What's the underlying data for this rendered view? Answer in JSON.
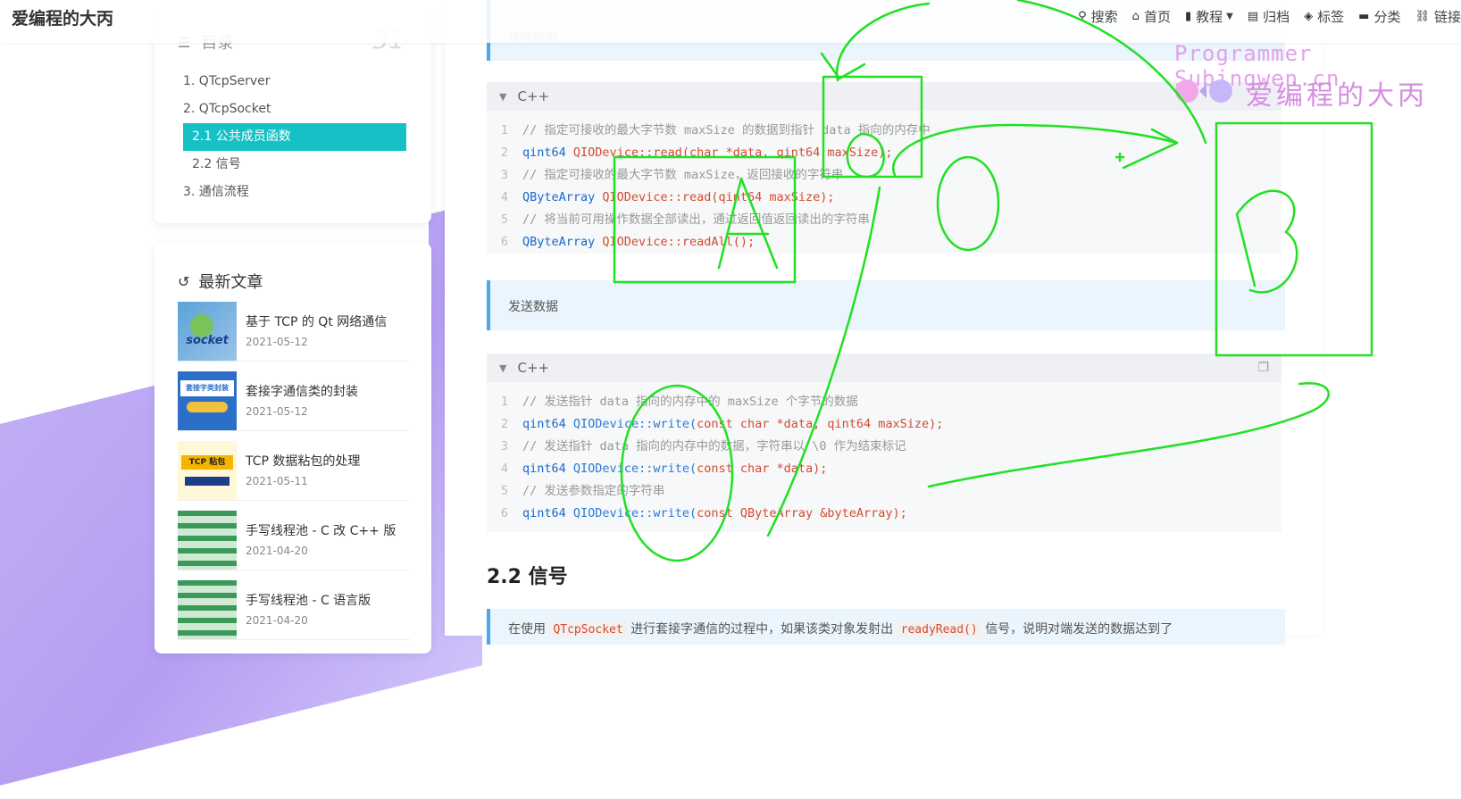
{
  "brand": "爱编程的大丙",
  "nav": [
    {
      "icon": "search-icon",
      "glyph": "⚲",
      "label": "搜索"
    },
    {
      "icon": "home-icon",
      "glyph": "⌂",
      "label": "首页"
    },
    {
      "icon": "bookmark-icon",
      "glyph": "▮",
      "label": "教程"
    },
    {
      "icon": "archive-icon",
      "glyph": "▤",
      "label": "归档"
    },
    {
      "icon": "tags-icon",
      "glyph": "◈",
      "label": "标签"
    },
    {
      "icon": "folder-icon",
      "glyph": "▬",
      "label": "分类"
    },
    {
      "icon": "link-icon",
      "glyph": "⛓",
      "label": "链接"
    }
  ],
  "toc": {
    "title": "目录",
    "count": "31",
    "items": [
      {
        "label": "1. QTcpServer"
      },
      {
        "label": "2. QTcpSocket"
      },
      {
        "label": "2.1 公共成员函数"
      },
      {
        "label": "2.2 信号"
      },
      {
        "label": "3. 通信流程"
      }
    ]
  },
  "recent": {
    "title": "最新文章",
    "posts": [
      {
        "title": "基于 TCP 的 Qt 网络通信",
        "date": "2021-05-12",
        "thumb_text": "socket"
      },
      {
        "title": "套接字通信类的封装",
        "date": "2021-05-12",
        "thumb_text": "套接字类封装"
      },
      {
        "title": "TCP 数据粘包的处理",
        "date": "2021-05-11",
        "thumb_text": "TCP 粘包"
      },
      {
        "title": "手写线程池 - C 改 C++ 版",
        "date": "2021-04-20",
        "thumb_text": ""
      },
      {
        "title": "手写线程池 - C 语言版",
        "date": "2021-04-20",
        "thumb_text": ""
      }
    ]
  },
  "main": {
    "note_receive": "接收数据",
    "code_lang": "C++",
    "note_send": "发送数据",
    "heading": "2.2 信号",
    "bottom_note_a": "在使用",
    "bottom_note_code1": "QTcpSocket",
    "bottom_note_b": "进行套接字通信的过程中，如果该类对象发射出",
    "bottom_note_code2": "readyRead()",
    "bottom_note_c": "信号，说明对端发送的数据达到了"
  },
  "watermark": {
    "line1": "Programmer Subingwen.cn",
    "line2": "爱编程的大丙"
  },
  "colors": {
    "accent": "#16c1c6",
    "note_border": "#4aa7ee",
    "annotation": "#22e022"
  },
  "annotation_labels": [
    "A",
    "B"
  ]
}
